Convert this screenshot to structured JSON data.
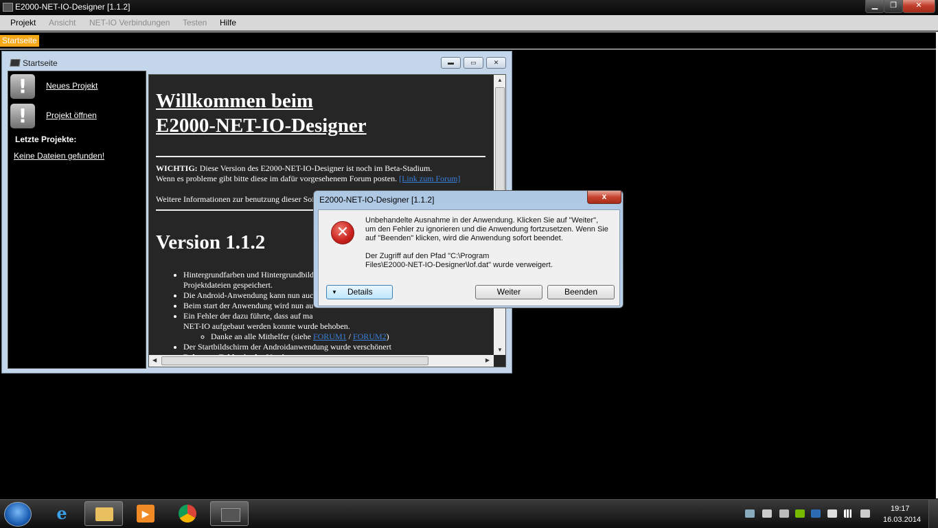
{
  "app": {
    "title": "E2000-NET-IO-Designer [1.1.2]"
  },
  "menu": {
    "items": [
      "Projekt",
      "Ansicht",
      "NET-IO Verbindungen",
      "Testen",
      "Hilfe"
    ]
  },
  "tabs": {
    "start": "Startseite"
  },
  "child": {
    "title": "Startseite",
    "new_project": "Neues Projekt",
    "open_project": "Projekt öffnen",
    "recent_label": "Letzte Projekte:",
    "no_files": "Keine Dateien gefunden!"
  },
  "content": {
    "heading_1": "Willkommen beim",
    "heading_2": "E2000-NET-IO-Designer",
    "important_label": "WICHTIG:",
    "important_text": " Diese Version des E2000-NET-IO-Designer ist noch im Beta-Stadium.",
    "forum_text": "Wenn es probleme gibt bitte diese im dafür vorgesehenem Forum posten. ",
    "forum_link": "[Link zum Forum]",
    "more_info": "Weitere Informationen zur benutzung dieser Sof",
    "version": "Version 1.1.2",
    "items": [
      "Hintergrundfarben und Hintergrundbild",
      "Projektdateien gespeichert.",
      "Die Android-Anwendung kann nun auch",
      "Beim start der Anwendung wird nun au",
      "Ein Fehler der dazu führte, dass auf ma",
      "NET-IO aufgebaut werden konnte wurde behoben.",
      "Der Startbildschirm der Androidanwendung wurde verschönert",
      "Bekannte Fehler in der Version:"
    ],
    "thanks_prefix": "Danke an alle Mithelfer (siehe ",
    "forum1": "FORUM1",
    "sep": " / ",
    "forum2": "FORUM2",
    "thanks_suffix": ")"
  },
  "dialog": {
    "title": "E2000-NET-IO-Designer [1.1.2]",
    "close": "x",
    "msg_1": "Unbehandelte Ausnahme in der Anwendung. Klicken Sie auf \"Weiter\",",
    "msg_2": "um den Fehler zu ignorieren und die Anwendung fortzusetzen. Wenn Sie",
    "msg_3": "auf \"Beenden\" klicken, wird die Anwendung sofort beendet.",
    "msg_4": "Der Zugriff auf den Pfad \"C:\\Program",
    "msg_5": "Files\\E2000-NET-IO-Designer\\lof.dat\" wurde verweigert.",
    "details": "Details",
    "continue": "Weiter",
    "quit": "Beenden"
  },
  "taskbar": {
    "time": "19:17",
    "date": "16.03.2014",
    "apps": [
      "internet-explorer-icon",
      "explorer-folder-icon",
      "media-player-icon",
      "chrome-icon",
      "net-io-designer-icon"
    ]
  }
}
